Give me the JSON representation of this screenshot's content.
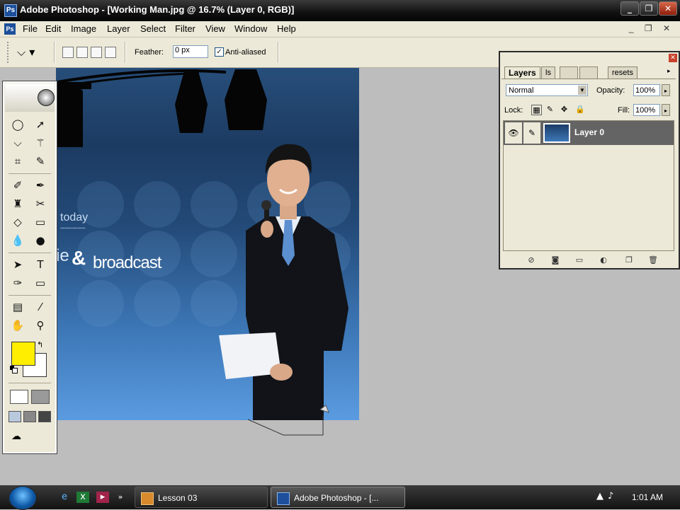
{
  "app": {
    "title": "Adobe Photoshop - [Working Man.jpg @ 16.7% (Layer 0, RGB)]",
    "logo_text": "Ps"
  },
  "window_controls": {
    "minimize": "_",
    "restore": "❐",
    "close": "✕"
  },
  "menu": {
    "items": [
      "File",
      "Edit",
      "Image",
      "Layer",
      "Select",
      "Filter",
      "View",
      "Window",
      "Help"
    ],
    "mdi_controls": "_ ❐ ✕"
  },
  "options_bar": {
    "tool_icon": "polygonal-lasso-icon",
    "feather_label": "Feather:",
    "feather_value": "0 px",
    "anti_aliased_label": "Anti-aliased",
    "anti_aliased_checked": true
  },
  "canvas": {
    "text_today": "today",
    "text_ie": "ie",
    "text_amp": "&",
    "text_broadcast": "broadcast"
  },
  "toolbox": {
    "foreground_color": "#ffee00",
    "background_color": "#ffffff"
  },
  "layers_panel": {
    "tabs": [
      "Layers",
      "ls",
      "",
      "",
      "resets"
    ],
    "blend_mode": "Normal",
    "opacity_label": "Opacity:",
    "opacity_value": "100%",
    "lock_label": "Lock:",
    "fill_label": "Fill:",
    "fill_value": "100%",
    "layers": [
      {
        "name": "Layer 0",
        "visible": true
      }
    ]
  },
  "taskbar": {
    "tasks": [
      "Lesson 03",
      "Adobe Photoshop - [..."
    ],
    "clock": "1:01 AM"
  }
}
